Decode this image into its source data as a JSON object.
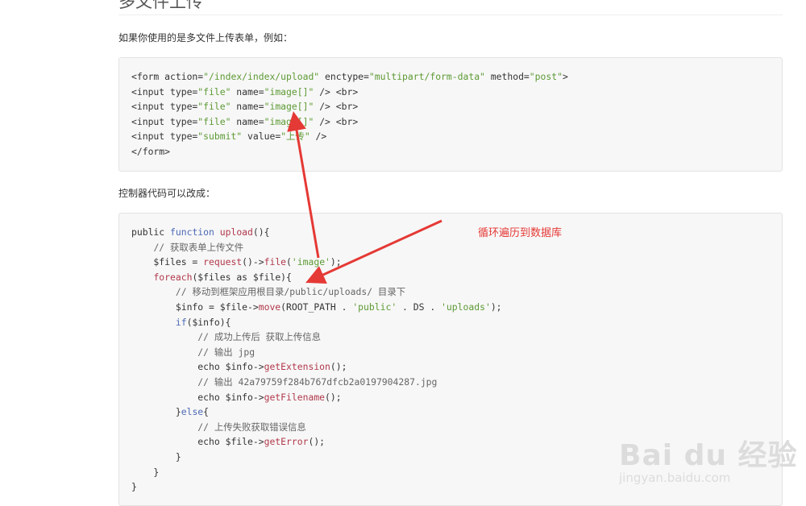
{
  "article": {
    "heading": "多文件上传",
    "intro": "如果你使用的是多文件上传表单，例如：",
    "controller_intro": "控制器代码可以改成："
  },
  "code_block_1": [
    [
      [
        "tag",
        "<form action="
      ],
      [
        "str",
        "\"/index/index/upload\""
      ],
      [
        "tag",
        " enctype="
      ],
      [
        "str",
        "\"multipart/form-data\""
      ],
      [
        "tag",
        " method="
      ],
      [
        "str",
        "\"post\""
      ],
      [
        "tag",
        ">"
      ]
    ],
    [
      [
        "tag",
        "<input type="
      ],
      [
        "str",
        "\"file\""
      ],
      [
        "tag",
        " name="
      ],
      [
        "str",
        "\"image[]\""
      ],
      [
        "tag",
        " /> <br>"
      ]
    ],
    [
      [
        "tag",
        "<input type="
      ],
      [
        "str",
        "\"file\""
      ],
      [
        "tag",
        " name="
      ],
      [
        "str",
        "\"image[]\""
      ],
      [
        "tag",
        " /> <br>"
      ]
    ],
    [
      [
        "tag",
        "<input type="
      ],
      [
        "str",
        "\"file\""
      ],
      [
        "tag",
        " name="
      ],
      [
        "str",
        "\"image[]\""
      ],
      [
        "tag",
        " /> <br>"
      ]
    ],
    [
      [
        "tag",
        "<input type="
      ],
      [
        "str",
        "\"submit\""
      ],
      [
        "tag",
        " value="
      ],
      [
        "str",
        "\"上传\""
      ],
      [
        "tag",
        " />"
      ]
    ],
    [
      [
        "tag",
        "</form>"
      ]
    ]
  ],
  "code_block_2": [
    [
      [
        "pl",
        "public "
      ],
      [
        "kw",
        "function"
      ],
      [
        "pl",
        " "
      ],
      [
        "fn",
        "upload"
      ],
      [
        "pl",
        "(){"
      ]
    ],
    [
      [
        "pl",
        "    "
      ],
      [
        "cm",
        "// 获取表单上传文件"
      ]
    ],
    [
      [
        "pl",
        "    $files = "
      ],
      [
        "fn",
        "request"
      ],
      [
        "pl",
        "()->"
      ],
      [
        "fn",
        "file"
      ],
      [
        "pl",
        "("
      ],
      [
        "str",
        "'image'"
      ],
      [
        "pl",
        ");"
      ]
    ],
    [
      [
        "pl",
        "    "
      ],
      [
        "fn",
        "foreach"
      ],
      [
        "pl",
        "($files as $file){"
      ]
    ],
    [
      [
        "pl",
        "        "
      ],
      [
        "cm",
        "// 移动到框架应用根目录/public/uploads/ 目录下"
      ]
    ],
    [
      [
        "pl",
        "        $info = $file->"
      ],
      [
        "fn",
        "move"
      ],
      [
        "pl",
        "(ROOT_PATH . "
      ],
      [
        "str",
        "'public'"
      ],
      [
        "pl",
        " . DS . "
      ],
      [
        "str",
        "'uploads'"
      ],
      [
        "pl",
        ");"
      ]
    ],
    [
      [
        "pl",
        "        "
      ],
      [
        "kw",
        "if"
      ],
      [
        "pl",
        "($info){"
      ]
    ],
    [
      [
        "pl",
        "            "
      ],
      [
        "cm",
        "// 成功上传后 获取上传信息"
      ]
    ],
    [
      [
        "pl",
        "            "
      ],
      [
        "cm",
        "// 输出 jpg"
      ]
    ],
    [
      [
        "pl",
        "            echo $info->"
      ],
      [
        "fn",
        "getExtension"
      ],
      [
        "pl",
        "();"
      ]
    ],
    [
      [
        "pl",
        "            "
      ],
      [
        "cm",
        "// 输出 42a79759f284b767dfcb2a0197904287.jpg"
      ]
    ],
    [
      [
        "pl",
        "            echo $info->"
      ],
      [
        "fn",
        "getFilename"
      ],
      [
        "pl",
        "();"
      ]
    ],
    [
      [
        "pl",
        "        }"
      ],
      [
        "kw",
        "else"
      ],
      [
        "pl",
        "{"
      ]
    ],
    [
      [
        "pl",
        "            "
      ],
      [
        "cm",
        "// 上传失败获取错误信息"
      ]
    ],
    [
      [
        "pl",
        "            echo $file->"
      ],
      [
        "fn",
        "getError"
      ],
      [
        "pl",
        "();"
      ]
    ],
    [
      [
        "pl",
        "        }"
      ]
    ],
    [
      [
        "pl",
        "    }"
      ]
    ],
    [
      [
        "pl",
        "}"
      ]
    ]
  ],
  "annotation": {
    "text": "循环遍历到数据库",
    "color": "#e53935"
  },
  "watermark": {
    "logo": "Bai du 经验",
    "sub": "jingyan.baidu.com"
  },
  "colors": {
    "string": "#5d9a34",
    "keyword": "#4c69b5",
    "function": "#b1394b",
    "comment": "#666666"
  }
}
